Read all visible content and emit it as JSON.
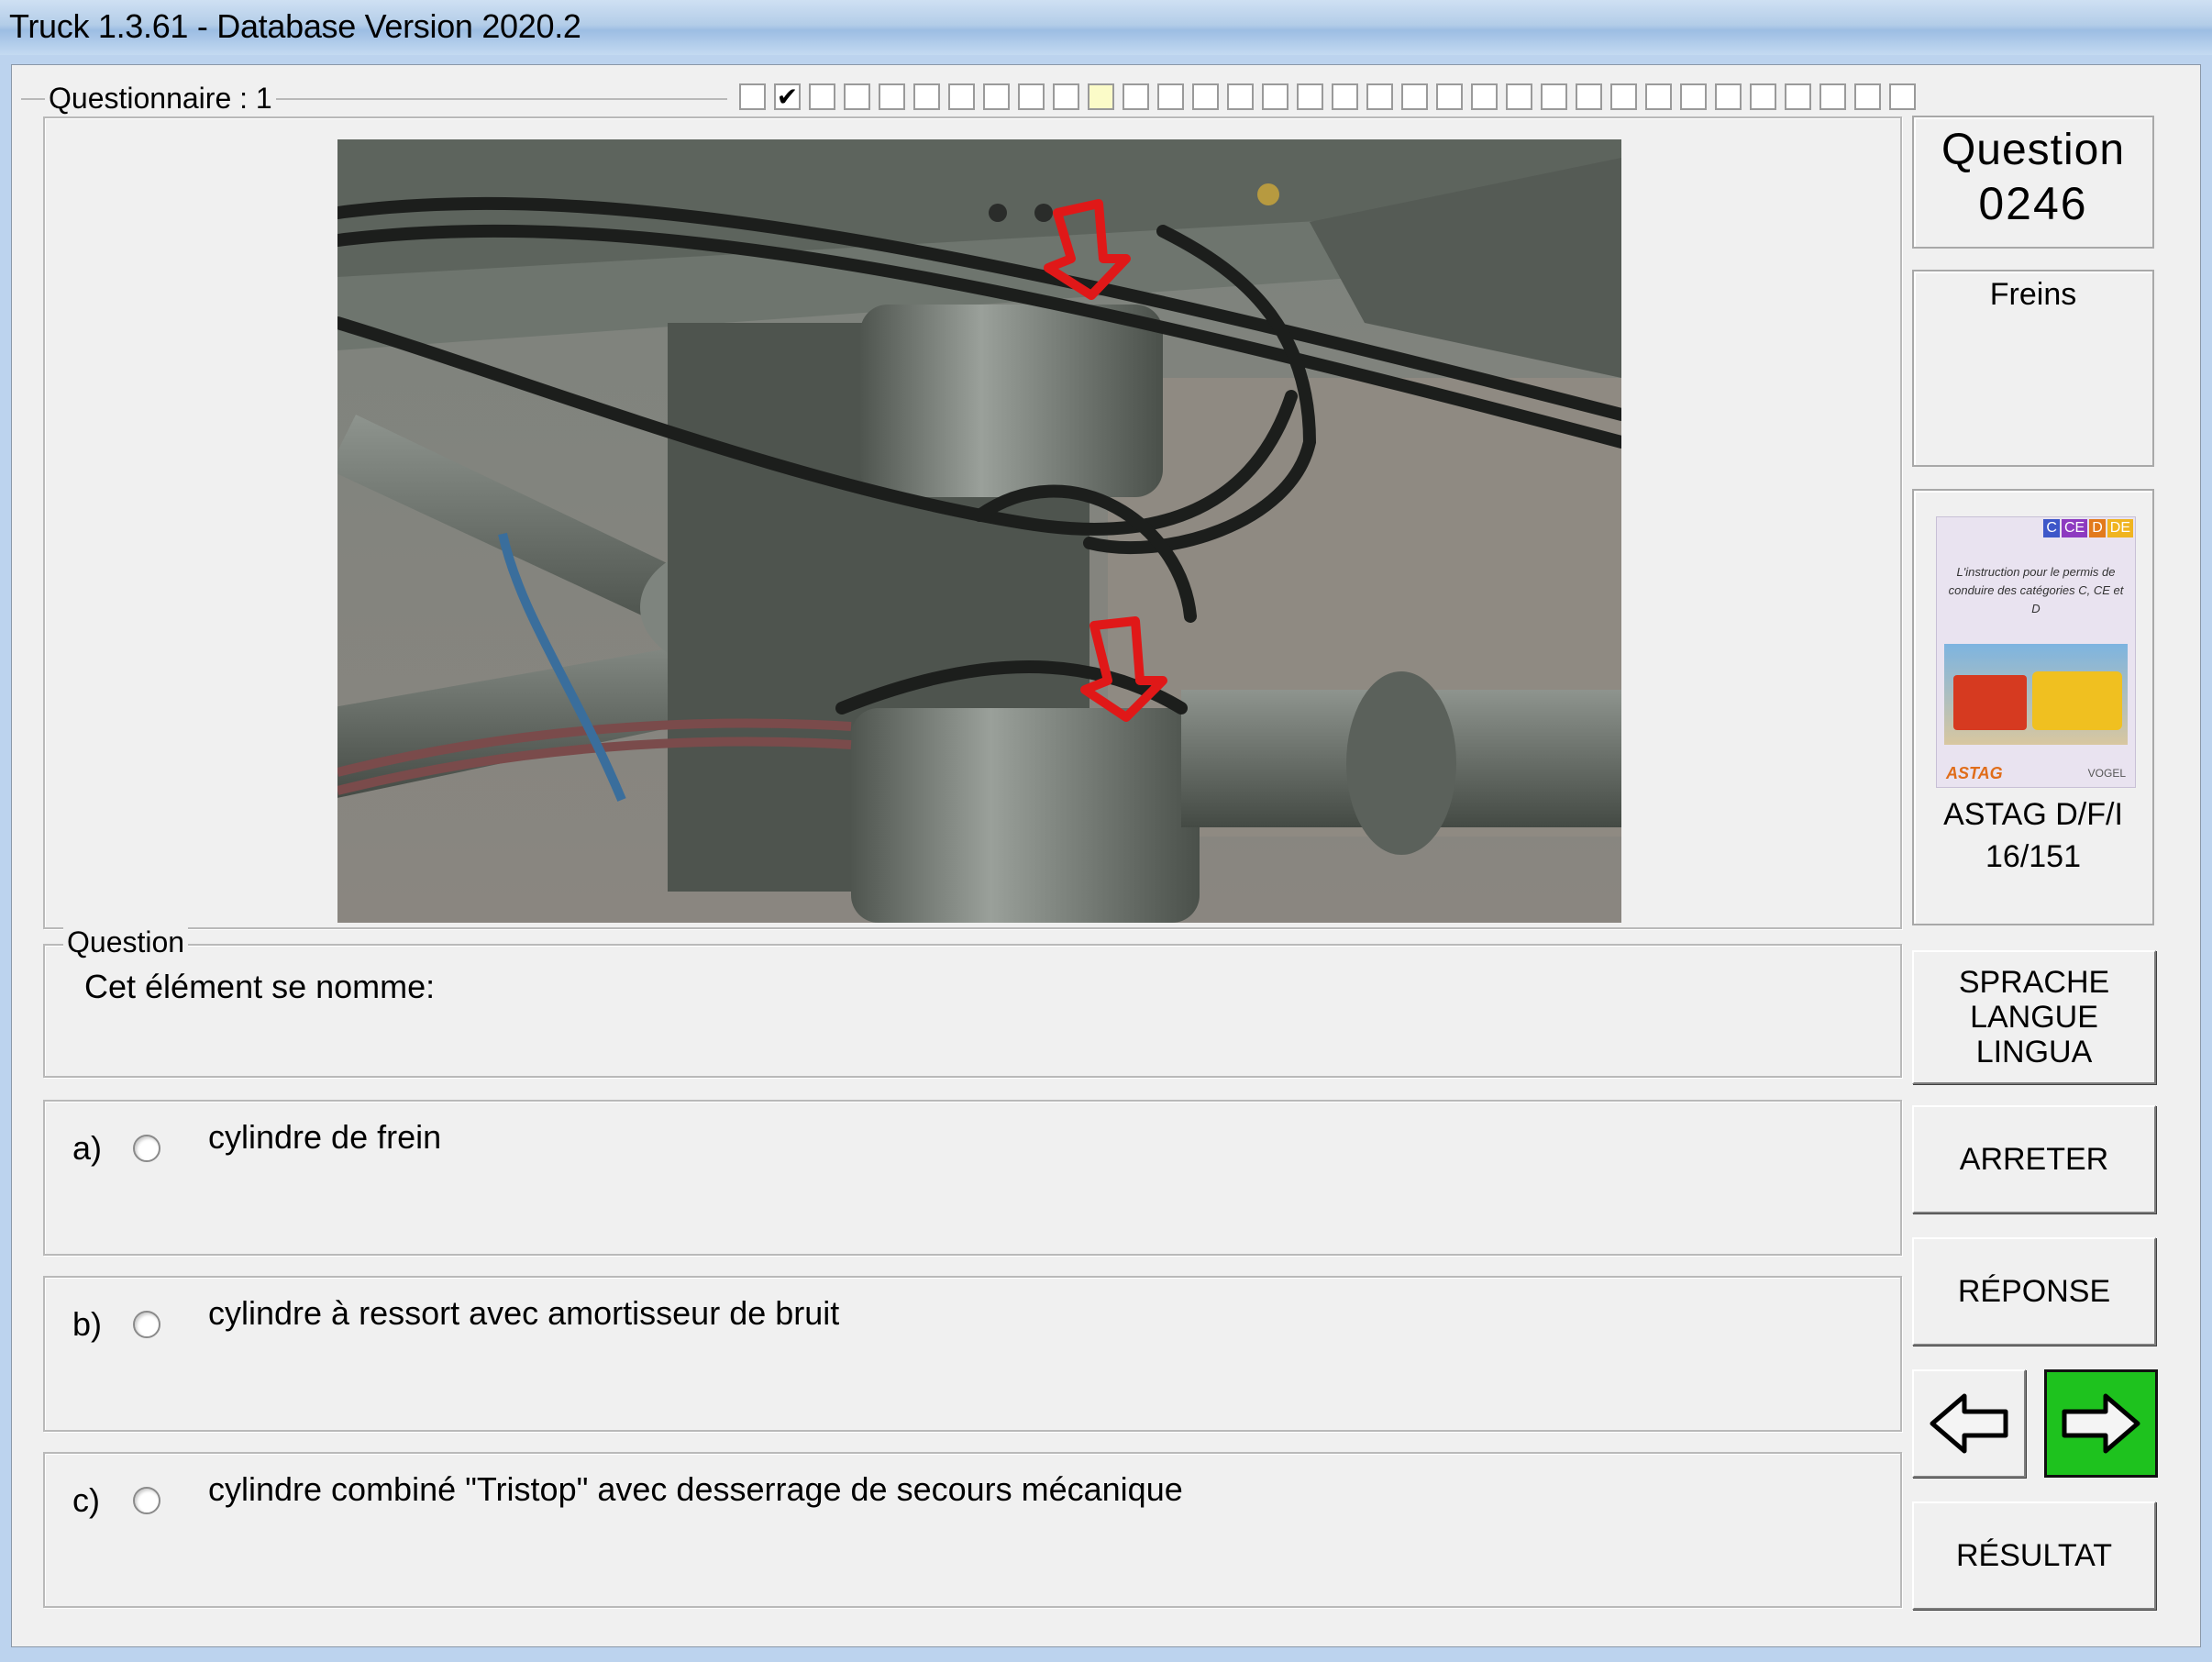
{
  "window": {
    "title": "Truck 1.3.61 - Database Version 2020.2"
  },
  "questionnaire": {
    "label": "Questionnaire : 1",
    "progress_cells_total": 34,
    "progress_checked_index": 1,
    "progress_current_index": 10,
    "check_glyph": "✔"
  },
  "question_panel": {
    "number_label": "Question",
    "number": "0246",
    "category": "Freins",
    "book_title": "ASTAG D/F/I",
    "book_page": "16/151",
    "book_cover": {
      "badges": [
        "C",
        "CE",
        "D",
        "DE"
      ],
      "text": "L'instruction pour le permis de conduire des catégories C, CE et D",
      "brand": "ASTAG",
      "publisher": "VOGEL"
    }
  },
  "question": {
    "legend": "Question",
    "text": "Cet élément se nomme:"
  },
  "answers": [
    {
      "letter": "a)",
      "text": "cylindre de frein"
    },
    {
      "letter": "b)",
      "text": "cylindre à ressort avec amortisseur de bruit"
    },
    {
      "letter": "c)",
      "text": "cylindre combiné \"Tristop\"  avec desserrage de secours mécanique"
    }
  ],
  "buttons": {
    "language": [
      "SPRACHE",
      "LANGUE",
      "LINGUA"
    ],
    "stop": "ARRETER",
    "answer": "RÉPONSE",
    "result": "RÉSULTAT"
  },
  "colors": {
    "next_button": "#1ec21e",
    "arrow_markers": "#e01818"
  }
}
